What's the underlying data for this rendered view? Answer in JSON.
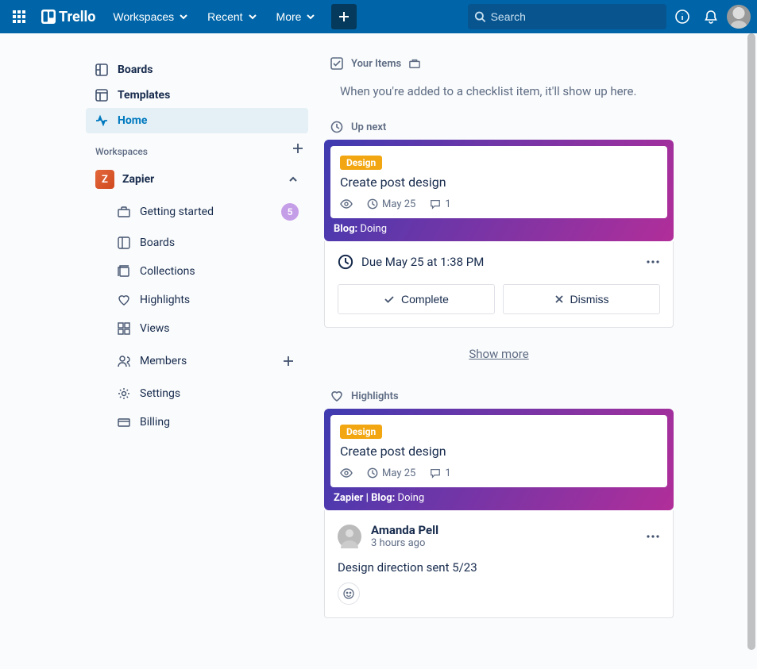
{
  "header": {
    "logo": "Trello",
    "nav": {
      "workspaces": "Workspaces",
      "recent": "Recent",
      "more": "More"
    },
    "search_placeholder": "Search"
  },
  "sidebar": {
    "boards": "Boards",
    "templates": "Templates",
    "home": "Home",
    "workspaces_label": "Workspaces",
    "workspace": {
      "initial": "Z",
      "name": "Zapier",
      "items": {
        "getting_started": "Getting started",
        "getting_started_count": "5",
        "boards": "Boards",
        "collections": "Collections",
        "highlights": "Highlights",
        "views": "Views",
        "members": "Members",
        "settings": "Settings",
        "billing": "Billing"
      }
    }
  },
  "feed": {
    "your_items_label": "Your Items",
    "your_items_empty": "When you're added to a checklist item, it'll show up here.",
    "up_next_label": "Up next",
    "card1": {
      "label": "Design",
      "title": "Create post design",
      "date": "May 25",
      "comments": "1",
      "footer_board": "Blog:",
      "footer_list": "Doing",
      "due_text": "Due May 25 at 1:38 PM",
      "complete": "Complete",
      "dismiss": "Dismiss"
    },
    "show_more": "Show more",
    "highlights_label": "Highlights",
    "card2": {
      "label": "Design",
      "title": "Create post design",
      "date": "May 25",
      "comments": "1",
      "footer_board": "Zapier | Blog:",
      "footer_list": "Doing",
      "person_name": "Amanda Pell",
      "person_time": "3 hours ago",
      "comment": "Design direction sent 5/23"
    }
  }
}
